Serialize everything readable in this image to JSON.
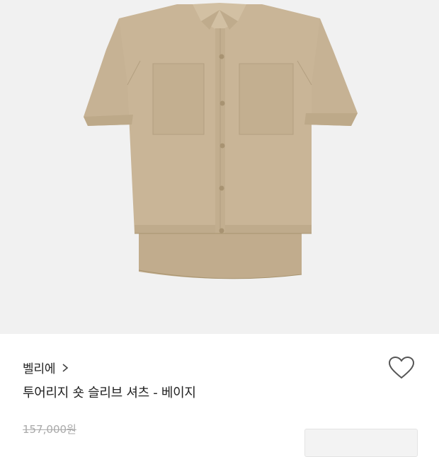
{
  "product_image": {
    "alt": "",
    "background": "#f1f1f1",
    "garment_color": "#c6b294"
  },
  "brand": {
    "name": "벨리에",
    "chevron": "chevron-right-icon"
  },
  "product": {
    "title": "투어리지 숏 슬리브 셔츠 - 베이지"
  },
  "price": {
    "original": "157,000원"
  },
  "coupon_button": {
    "label": ""
  },
  "wishlist": {
    "icon": "heart-outline-icon"
  }
}
